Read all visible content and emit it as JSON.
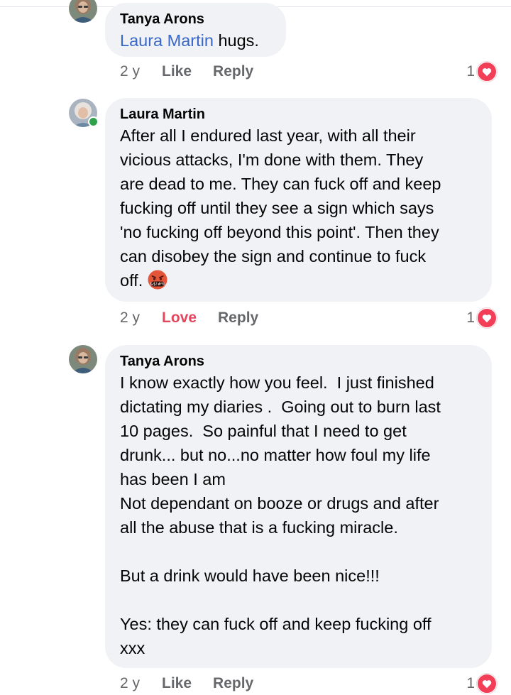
{
  "comments": [
    {
      "author": "Tanya Arons",
      "mention": "Laura Martin",
      "text": " hugs.",
      "age": "2 y",
      "action": "Like",
      "reply": "Reply",
      "reaction_count": "1",
      "avatar_icon": "profile-photo-woman-glasses",
      "reaction_icon": "love-heart-icon"
    },
    {
      "author": "Laura Martin",
      "text": "After all I endured last year, with all their\nvicious attacks, I'm done with them. They\nare dead to me. They can fuck off and keep\nfucking off until they see a sign which says\n'no fucking off beyond this point'. Then they\ncan disobey the sign and continue to fuck\noff.",
      "emoji": "face-with-symbols-on-mouth-emoji",
      "emoji_text": "&$!#%",
      "age": "2 y",
      "action": "Love",
      "reply": "Reply",
      "reaction_count": "1",
      "avatar_icon": "profile-photo-woman-white-hair",
      "online": true,
      "reaction_icon": "love-heart-icon"
    },
    {
      "author": "Tanya Arons",
      "text": "I know exactly how you feel.  I just finished\ndictating my diaries .  Going out to burn last\n10 pages.  So painful that I need to get\ndrunk... but no...no matter how foul my life\nhas been I am\nNot dependant on booze or drugs and after\nall the abuse that is a fucking miracle.\n\nBut a drink would have been nice!!!\n\nYes: they can fuck off and keep fucking off\nxxx",
      "age": "2 y",
      "action": "Like",
      "reply": "Reply",
      "reaction_count": "1",
      "avatar_icon": "profile-photo-woman-glasses",
      "reaction_icon": "love-heart-icon"
    }
  ],
  "colors": {
    "bubble": "#f0f2f5",
    "mention": "#3a68c9",
    "meta": "#65676b",
    "love": "#e4465e",
    "heart": "#f33e58",
    "online": "#31a24c"
  }
}
